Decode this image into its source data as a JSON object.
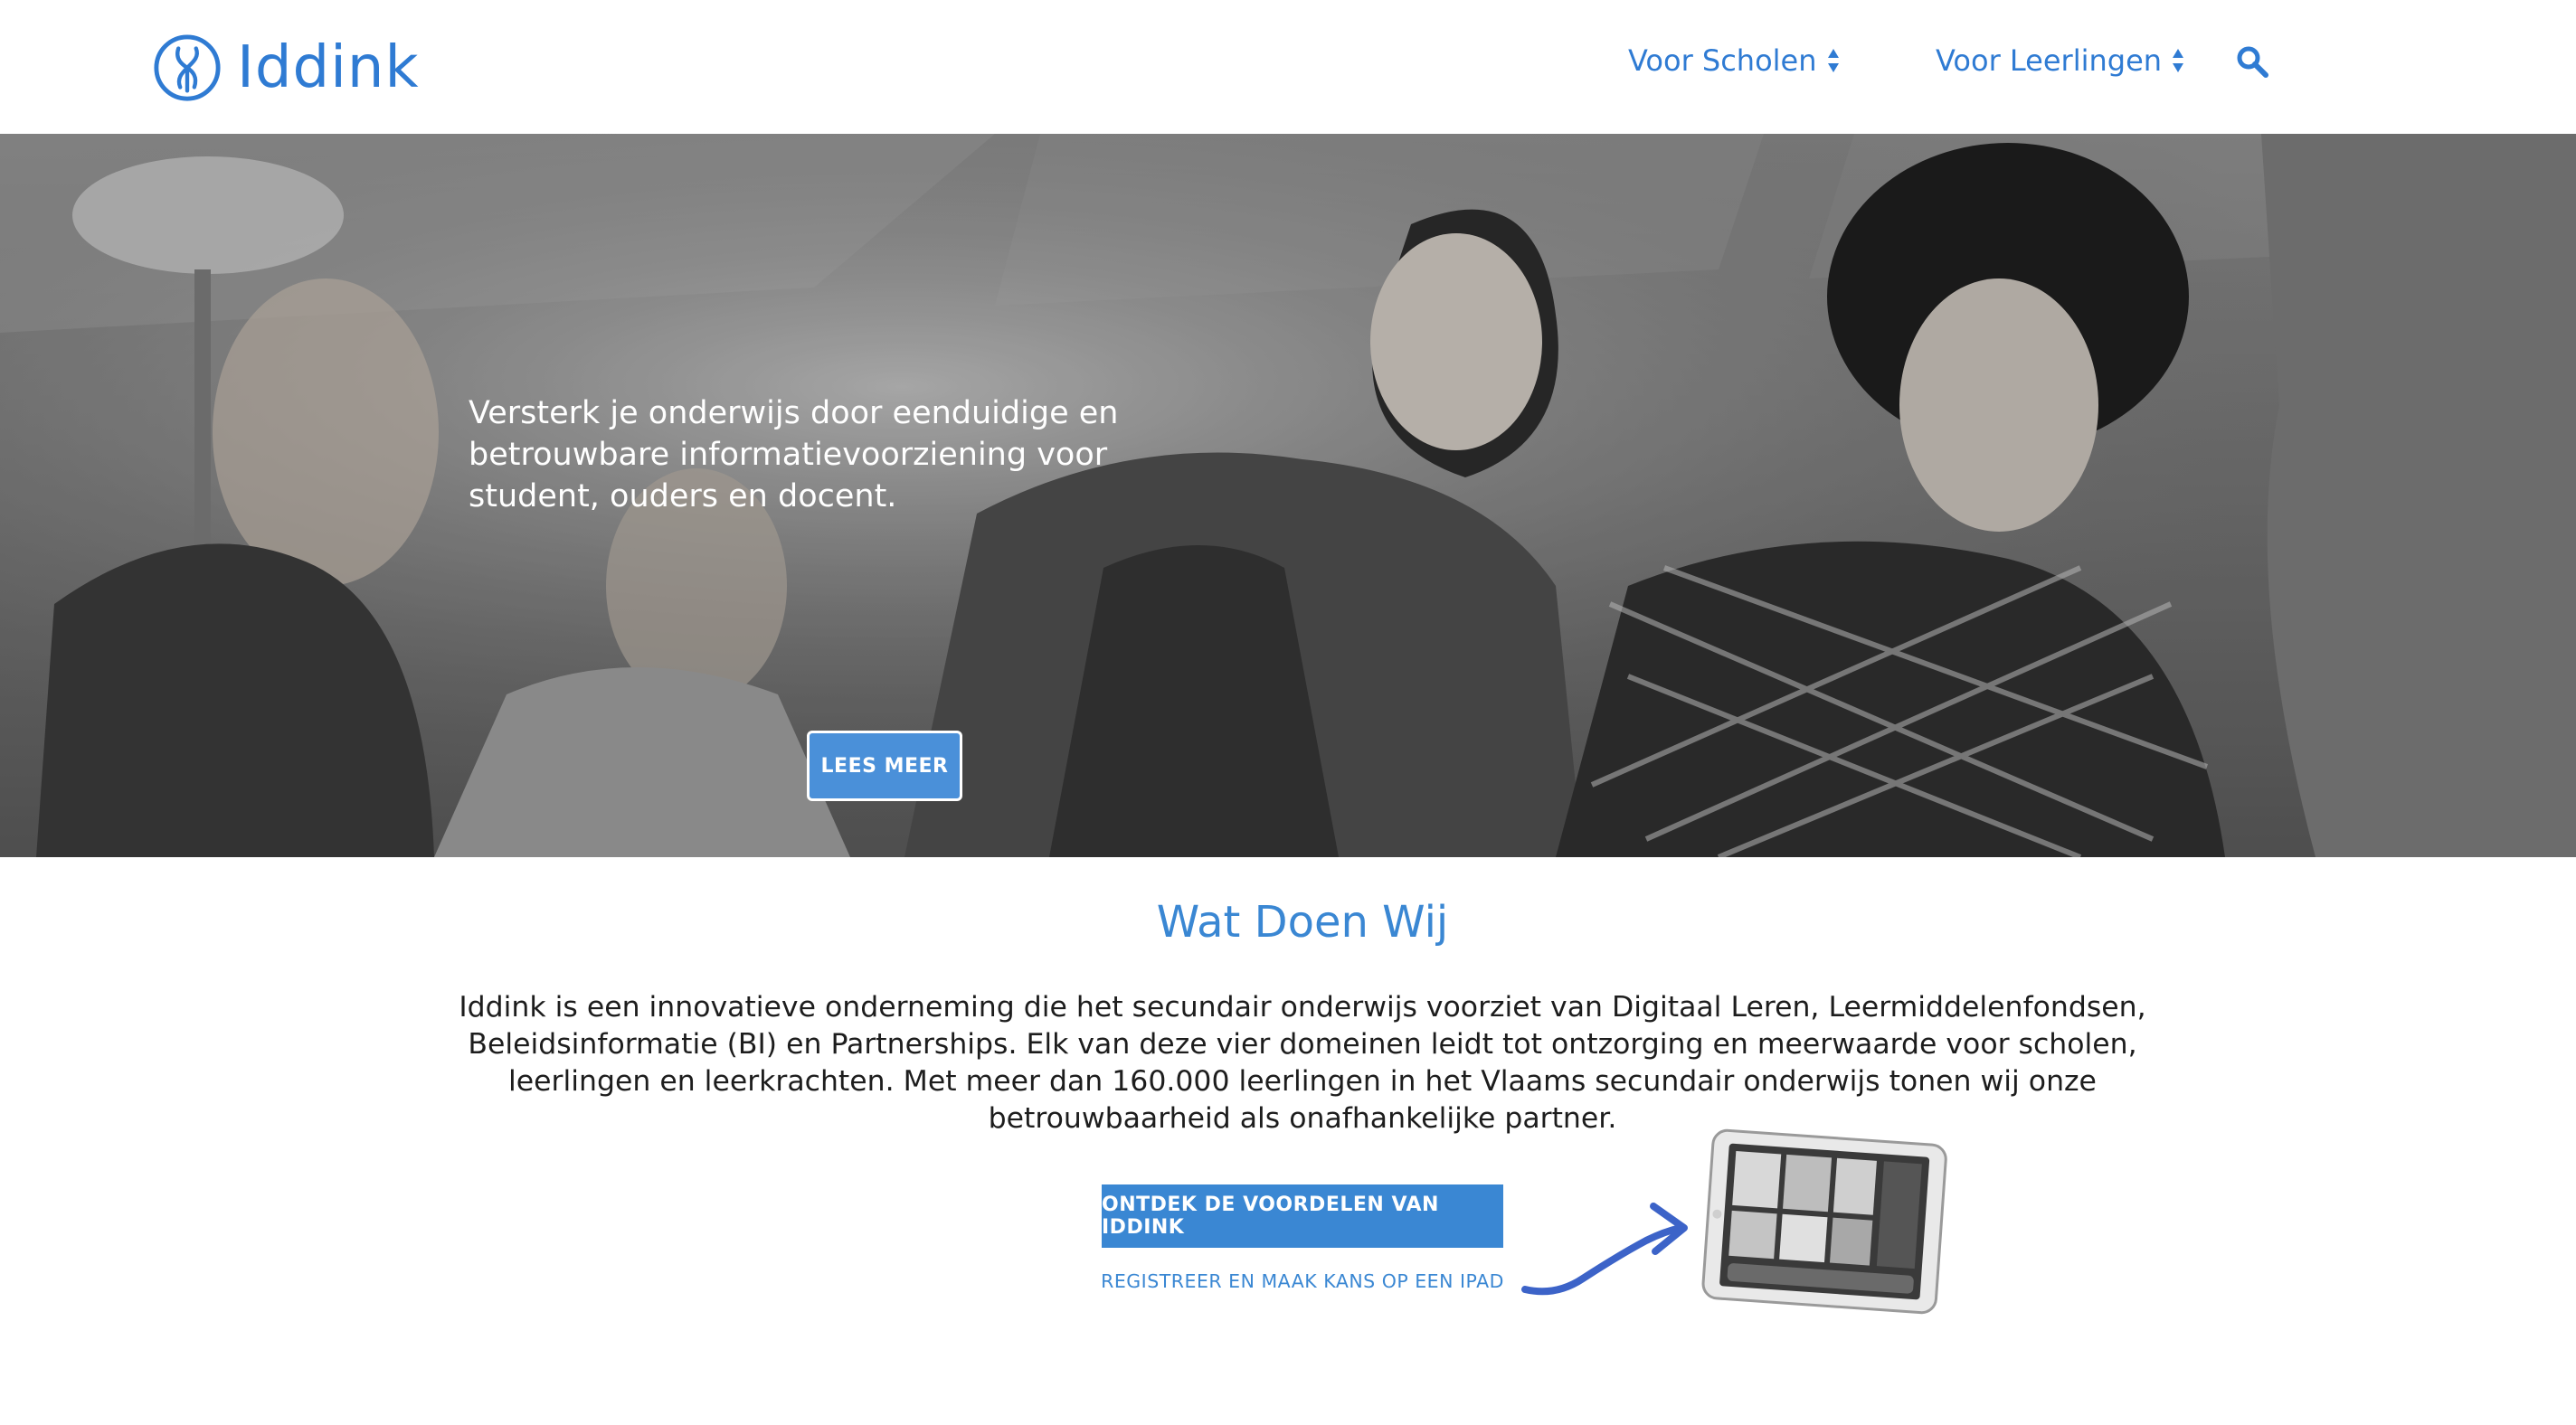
{
  "brand": {
    "name": "Iddink",
    "color": "#2f7bd3"
  },
  "nav": {
    "items": [
      {
        "label": "Voor Scholen",
        "icon": "sort-updown-icon"
      },
      {
        "label": "Voor Leerlingen",
        "icon": "sort-updown-icon"
      }
    ],
    "search_icon": "search-icon"
  },
  "hero": {
    "text": "Versterk je onderwijs door eenduidige en betrouwbare informatievoorziening voor student, ouders en docent.",
    "button_label": "LEES MEER"
  },
  "section": {
    "title": "Wat Doen Wij",
    "body": "Iddink is een innovatieve onderneming die het secundair onderwijs voorziet van Digitaal Leren, Leermiddelenfondsen, Beleidsinformatie (BI) en Partnerships. Elk van deze vier domeinen leidt tot ontzorging en meerwaarde voor scholen, leerlingen en leerkrachten. Met meer dan 160.000 leerlingen in het Vlaams secundair onderwijs tonen wij onze betrouwbaarheid als onafhankelijke partner.",
    "cta_label": "ONTDEK DE VOORDELEN VAN IDDINK",
    "link_label": "REGISTREER EN MAAK KANS OP EEN IPAD"
  },
  "colors": {
    "accent": "#3a87d3",
    "button": "#4a90d9"
  }
}
